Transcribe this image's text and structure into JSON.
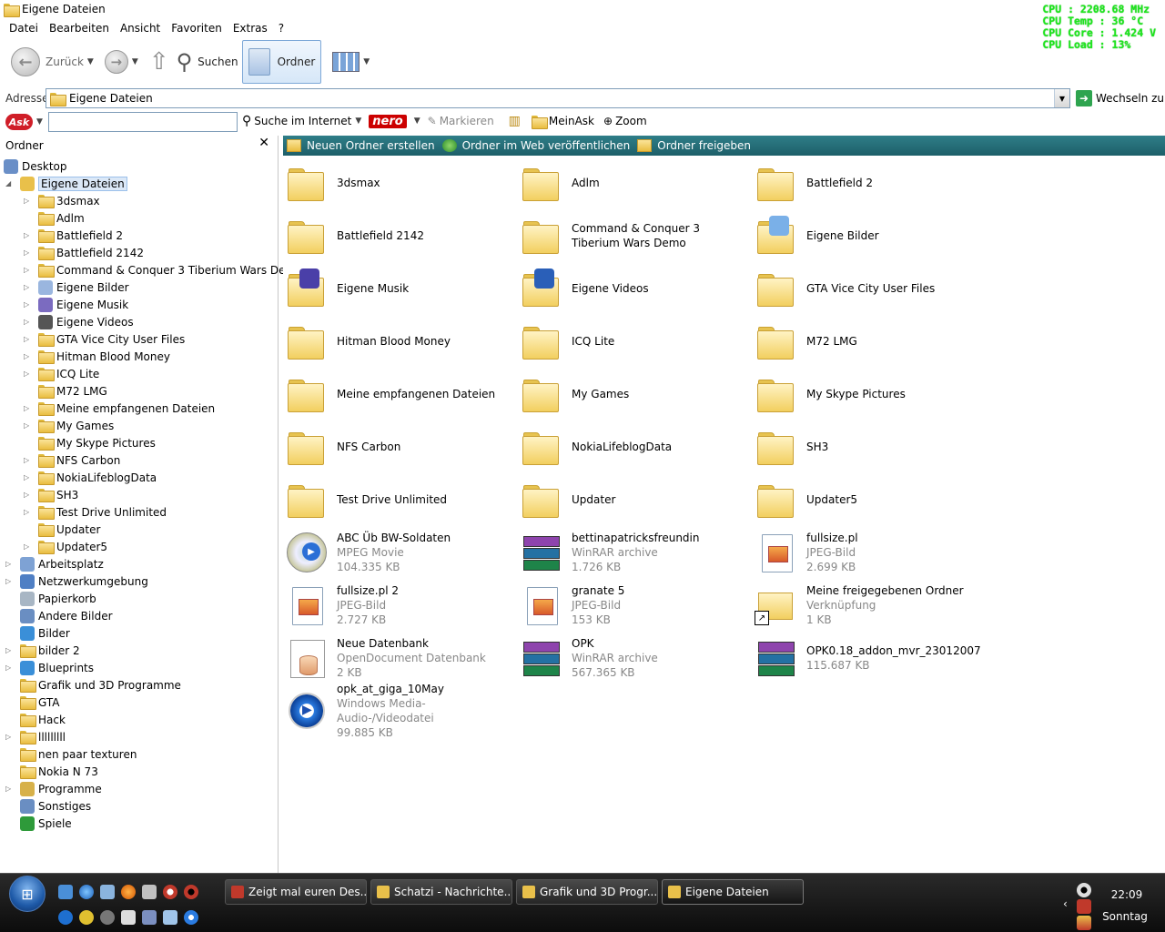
{
  "window": {
    "title": "Eigene Dateien"
  },
  "cpu": {
    "line1": "CPU : 2208.68 MHz",
    "line2": "CPU Temp : 36 °C",
    "line3": "CPU Core : 1.424 V",
    "line4": "CPU Load : 13%"
  },
  "menu": [
    "Datei",
    "Bearbeiten",
    "Ansicht",
    "Favoriten",
    "Extras",
    "?"
  ],
  "toolbar": {
    "back_label": "Zurück",
    "search_label": "Suchen",
    "folders_label": "Ordner"
  },
  "address": {
    "label": "Adresse",
    "value": "Eigene Dateien",
    "go_label": "Wechseln zu"
  },
  "askbar": {
    "logo": "Ask",
    "search_label": "Suche im Internet",
    "nero_label": "nero",
    "highlight_label": "Markieren",
    "myask_label": "MeinAsk",
    "zoom_label": "Zoom"
  },
  "leftpane": {
    "header": "Ordner",
    "close": "✕",
    "tree": [
      {
        "label": "Desktop",
        "indent": 0,
        "exp": "",
        "icon": "desktop-icon",
        "color": "#6a8fc7"
      },
      {
        "label": "Eigene Dateien",
        "indent": 1,
        "exp": "◢",
        "icon": "my-documents-icon",
        "color": "#e9c04a",
        "selected": true
      },
      {
        "label": "3dsmax",
        "indent": 2,
        "exp": "▷",
        "icon": "folder-icon"
      },
      {
        "label": "Adlm",
        "indent": 2,
        "exp": "",
        "icon": "folder-icon"
      },
      {
        "label": "Battlefield 2",
        "indent": 2,
        "exp": "▷",
        "icon": "folder-icon"
      },
      {
        "label": "Battlefield 2142",
        "indent": 2,
        "exp": "▷",
        "icon": "folder-icon"
      },
      {
        "label": "Command & Conquer 3 Tiberium Wars Demo",
        "indent": 2,
        "exp": "▷",
        "icon": "folder-icon"
      },
      {
        "label": "Eigene Bilder",
        "indent": 2,
        "exp": "▷",
        "icon": "pictures-folder-icon",
        "color": "#9ab6df"
      },
      {
        "label": "Eigene Musik",
        "indent": 2,
        "exp": "▷",
        "icon": "music-folder-icon",
        "color": "#7b6bc0"
      },
      {
        "label": "Eigene Videos",
        "indent": 2,
        "exp": "▷",
        "icon": "videos-folder-icon",
        "color": "#555"
      },
      {
        "label": "GTA Vice City User Files",
        "indent": 2,
        "exp": "▷",
        "icon": "folder-icon"
      },
      {
        "label": "Hitman Blood Money",
        "indent": 2,
        "exp": "▷",
        "icon": "folder-icon"
      },
      {
        "label": "ICQ Lite",
        "indent": 2,
        "exp": "▷",
        "icon": "folder-icon"
      },
      {
        "label": "M72 LMG",
        "indent": 2,
        "exp": "",
        "icon": "folder-icon"
      },
      {
        "label": "Meine empfangenen Dateien",
        "indent": 2,
        "exp": "▷",
        "icon": "folder-icon"
      },
      {
        "label": "My Games",
        "indent": 2,
        "exp": "▷",
        "icon": "folder-icon"
      },
      {
        "label": "My Skype Pictures",
        "indent": 2,
        "exp": "",
        "icon": "folder-icon"
      },
      {
        "label": "NFS Carbon",
        "indent": 2,
        "exp": "▷",
        "icon": "folder-icon"
      },
      {
        "label": "NokiaLifeblogData",
        "indent": 2,
        "exp": "▷",
        "icon": "folder-icon"
      },
      {
        "label": "SH3",
        "indent": 2,
        "exp": "▷",
        "icon": "folder-icon"
      },
      {
        "label": "Test Drive Unlimited",
        "indent": 2,
        "exp": "▷",
        "icon": "folder-icon"
      },
      {
        "label": "Updater",
        "indent": 2,
        "exp": "",
        "icon": "folder-icon"
      },
      {
        "label": "Updater5",
        "indent": 2,
        "exp": "▷",
        "icon": "folder-icon"
      },
      {
        "label": "Arbeitsplatz",
        "indent": 1,
        "exp": "▷",
        "icon": "computer-icon",
        "color": "#7ea2d4"
      },
      {
        "label": "Netzwerkumgebung",
        "indent": 1,
        "exp": "▷",
        "icon": "network-icon",
        "color": "#4f7fc4"
      },
      {
        "label": "Papierkorb",
        "indent": 1,
        "exp": "",
        "icon": "recycle-bin-icon",
        "color": "#a8b6c4"
      },
      {
        "label": "Andere Bilder",
        "indent": 1,
        "exp": "",
        "icon": "info-icon",
        "color": "#6a8ec2"
      },
      {
        "label": "Bilder",
        "indent": 1,
        "exp": "",
        "icon": "globe-icon",
        "color": "#3a8fd8"
      },
      {
        "label": "bilder 2",
        "indent": 1,
        "exp": "▷",
        "icon": "folder-icon"
      },
      {
        "label": "Blueprints",
        "indent": 1,
        "exp": "▷",
        "icon": "globe-icon",
        "color": "#3a8fd8"
      },
      {
        "label": "Grafik und 3D Programme",
        "indent": 1,
        "exp": "",
        "icon": "folder-icon"
      },
      {
        "label": "GTA",
        "indent": 1,
        "exp": "",
        "icon": "folder-icon"
      },
      {
        "label": "Hack",
        "indent": 1,
        "exp": "",
        "icon": "folder-icon"
      },
      {
        "label": "lllllllll",
        "indent": 1,
        "exp": "▷",
        "icon": "folder-icon"
      },
      {
        "label": "nen paar texturen",
        "indent": 1,
        "exp": "",
        "icon": "folder-icon"
      },
      {
        "label": "Nokia N 73",
        "indent": 1,
        "exp": "",
        "icon": "folder-icon"
      },
      {
        "label": "Programme",
        "indent": 1,
        "exp": "▷",
        "icon": "programs-icon",
        "color": "#d7b14a"
      },
      {
        "label": "Sonstiges",
        "indent": 1,
        "exp": "",
        "icon": "search-icon",
        "color": "#6a8ec2"
      },
      {
        "label": "Spiele",
        "indent": 1,
        "exp": "",
        "icon": "tree-icon",
        "color": "#2e9a3a"
      }
    ]
  },
  "tasks": {
    "new_folder": "Neuen Ordner erstellen",
    "publish": "Ordner im Web veröffentlichen",
    "share": "Ordner freigeben"
  },
  "items": [
    {
      "name": "3dsmax",
      "kind": "folder"
    },
    {
      "name": "Adlm",
      "kind": "folder"
    },
    {
      "name": "Battlefield 2",
      "kind": "folder"
    },
    {
      "name": "Battlefield 2142",
      "kind": "folder"
    },
    {
      "name": "Command & Conquer 3 Tiberium Wars Demo",
      "kind": "folder"
    },
    {
      "name": "Eigene Bilder",
      "kind": "pictures"
    },
    {
      "name": "Eigene Musik",
      "kind": "music"
    },
    {
      "name": "Eigene Videos",
      "kind": "videos"
    },
    {
      "name": "GTA Vice City User Files",
      "kind": "folder"
    },
    {
      "name": "Hitman Blood Money",
      "kind": "folder"
    },
    {
      "name": "ICQ Lite",
      "kind": "folder"
    },
    {
      "name": "M72 LMG",
      "kind": "folder"
    },
    {
      "name": "Meine empfangenen Dateien",
      "kind": "folder"
    },
    {
      "name": "My Games",
      "kind": "folder"
    },
    {
      "name": "My Skype Pictures",
      "kind": "folder"
    },
    {
      "name": "NFS Carbon",
      "kind": "folder"
    },
    {
      "name": "NokiaLifeblogData",
      "kind": "folder"
    },
    {
      "name": "SH3",
      "kind": "folder"
    },
    {
      "name": "Test Drive Unlimited",
      "kind": "folder"
    },
    {
      "name": "Updater",
      "kind": "folder"
    },
    {
      "name": "Updater5",
      "kind": "folder"
    },
    {
      "name": "ABC Üb BW-Soldaten",
      "kind": "mpeg",
      "type": "MPEG Movie",
      "size": "104.335 KB"
    },
    {
      "name": "bettinapatricksfreundin",
      "kind": "rar",
      "type": "WinRAR archive",
      "size": "1.726 KB"
    },
    {
      "name": "fullsize.pl",
      "kind": "jpeg",
      "type": "JPEG-Bild",
      "size": "2.699 KB"
    },
    {
      "name": "fullsize.pl 2",
      "kind": "jpeg",
      "type": "JPEG-Bild",
      "size": "2.727 KB"
    },
    {
      "name": "granate 5",
      "kind": "jpeg",
      "type": "JPEG-Bild",
      "size": "153 KB"
    },
    {
      "name": "Meine freigegebenen Ordner",
      "kind": "shortcut",
      "type": "Verknüpfung",
      "size": "1 KB"
    },
    {
      "name": "Neue Datenbank",
      "kind": "db",
      "type": "OpenDocument Datenbank",
      "size": "2 KB"
    },
    {
      "name": "OPK",
      "kind": "rar",
      "type": "WinRAR archive",
      "size": "567.365 KB"
    },
    {
      "name": "OPK0.18_addon_mvr_23012007",
      "kind": "rar",
      "type": "",
      "size": "115.687 KB"
    },
    {
      "name": "opk_at_giga_10May",
      "kind": "wmv",
      "type": "Windows Media-Audio-/Videodatei",
      "size": "99.885 KB"
    }
  ],
  "taskbar": {
    "buttons": [
      {
        "label": "Zeigt mal euren Des...",
        "icon": "opera-icon",
        "color": "#c0392b"
      },
      {
        "label": "Schatzi - Nachrichte...",
        "icon": "messenger-icon",
        "color": "#e9c04a"
      },
      {
        "label": "Grafik und 3D Progr...",
        "icon": "folder-icon",
        "color": "#e9c04a"
      },
      {
        "label": "Eigene Dateien",
        "icon": "folder-icon",
        "color": "#e9c04a",
        "active": true
      }
    ],
    "clock": "22:09",
    "day": "Sonntag"
  }
}
